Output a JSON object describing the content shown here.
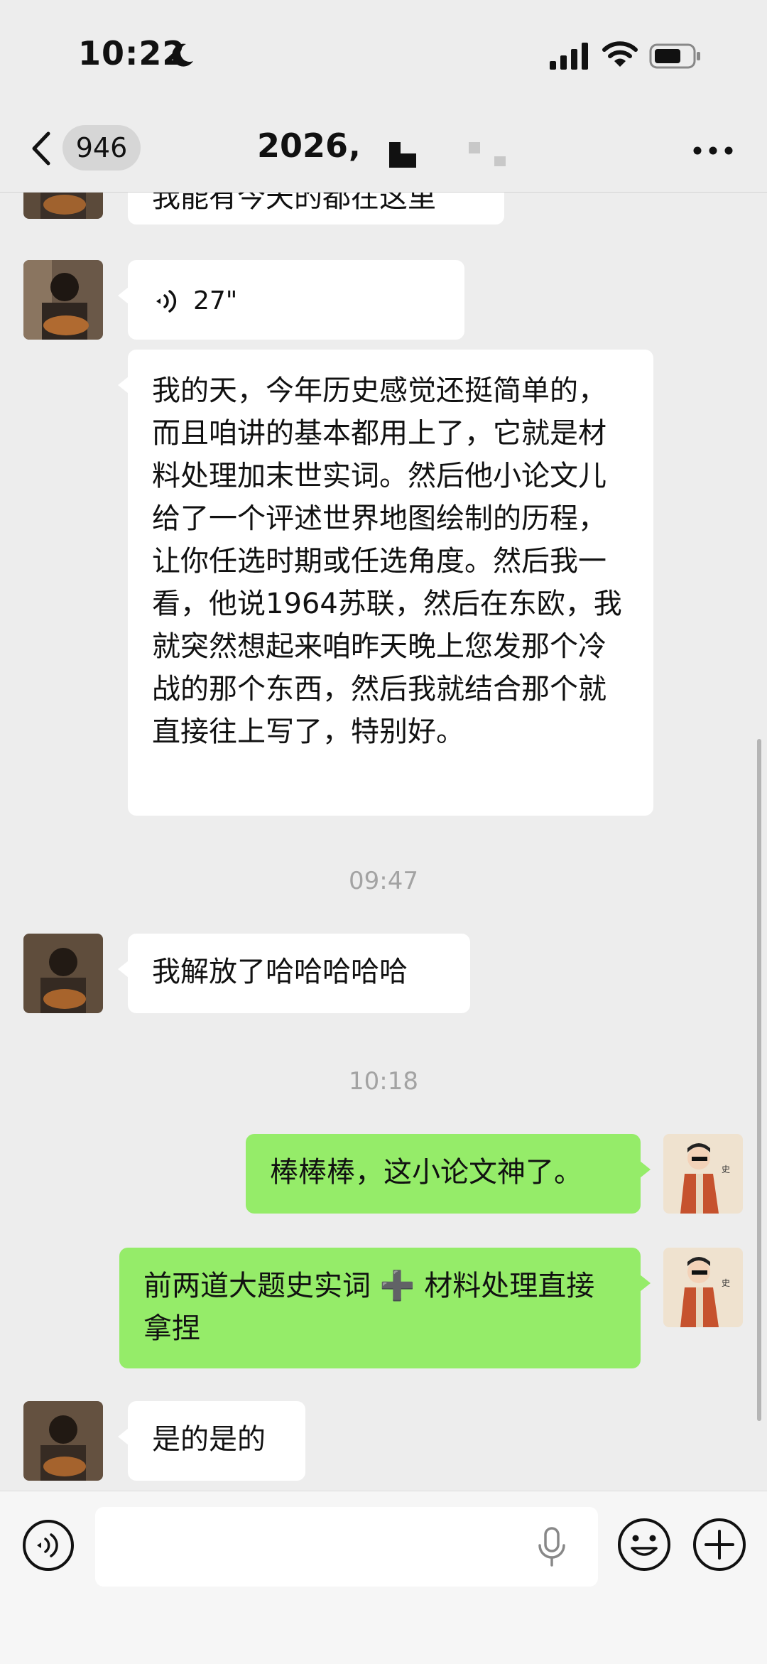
{
  "status_bar": {
    "time": "10:22"
  },
  "nav": {
    "unread_count": "946",
    "title": "2026‚"
  },
  "messages": {
    "partial_top": "我能有今天的都在这里",
    "voice_duration": "27\"",
    "long_text": "我的天，今年历史感觉还挺简单的，而且咱讲的基本都用上了，它就是材料处理加末世实词。然后他小论文儿给了一个评述世界地图绘制的历程，让你任选时期或任选角度。然后我一看，他说1964苏联，然后在东欧，我就突然想起来咱昨天晚上您发那个冷战的那个东西，然后我就结合那个就直接往上写了，特别好。",
    "time_1": "09:47",
    "reply_free": "我解放了哈哈哈哈哈",
    "time_2": "10:18",
    "out_1": "棒棒棒，这小论文神了。",
    "out_2": "前两道大题史实词 ➕ 材料处理直接拿捏",
    "in_last": "是的是的"
  },
  "input": {
    "value": ""
  },
  "colors": {
    "page_bg": "#ededed",
    "incoming": "#ffffff",
    "outgoing": "#95ec69",
    "timestamp": "#a3a3a3"
  },
  "icons": [
    "moon-icon",
    "signal-icon",
    "wifi-icon",
    "battery-icon",
    "back-chevron-icon",
    "more-icon",
    "voice-wave-icon",
    "voice-input-icon",
    "microphone-icon",
    "emoji-icon",
    "plus-icon"
  ]
}
